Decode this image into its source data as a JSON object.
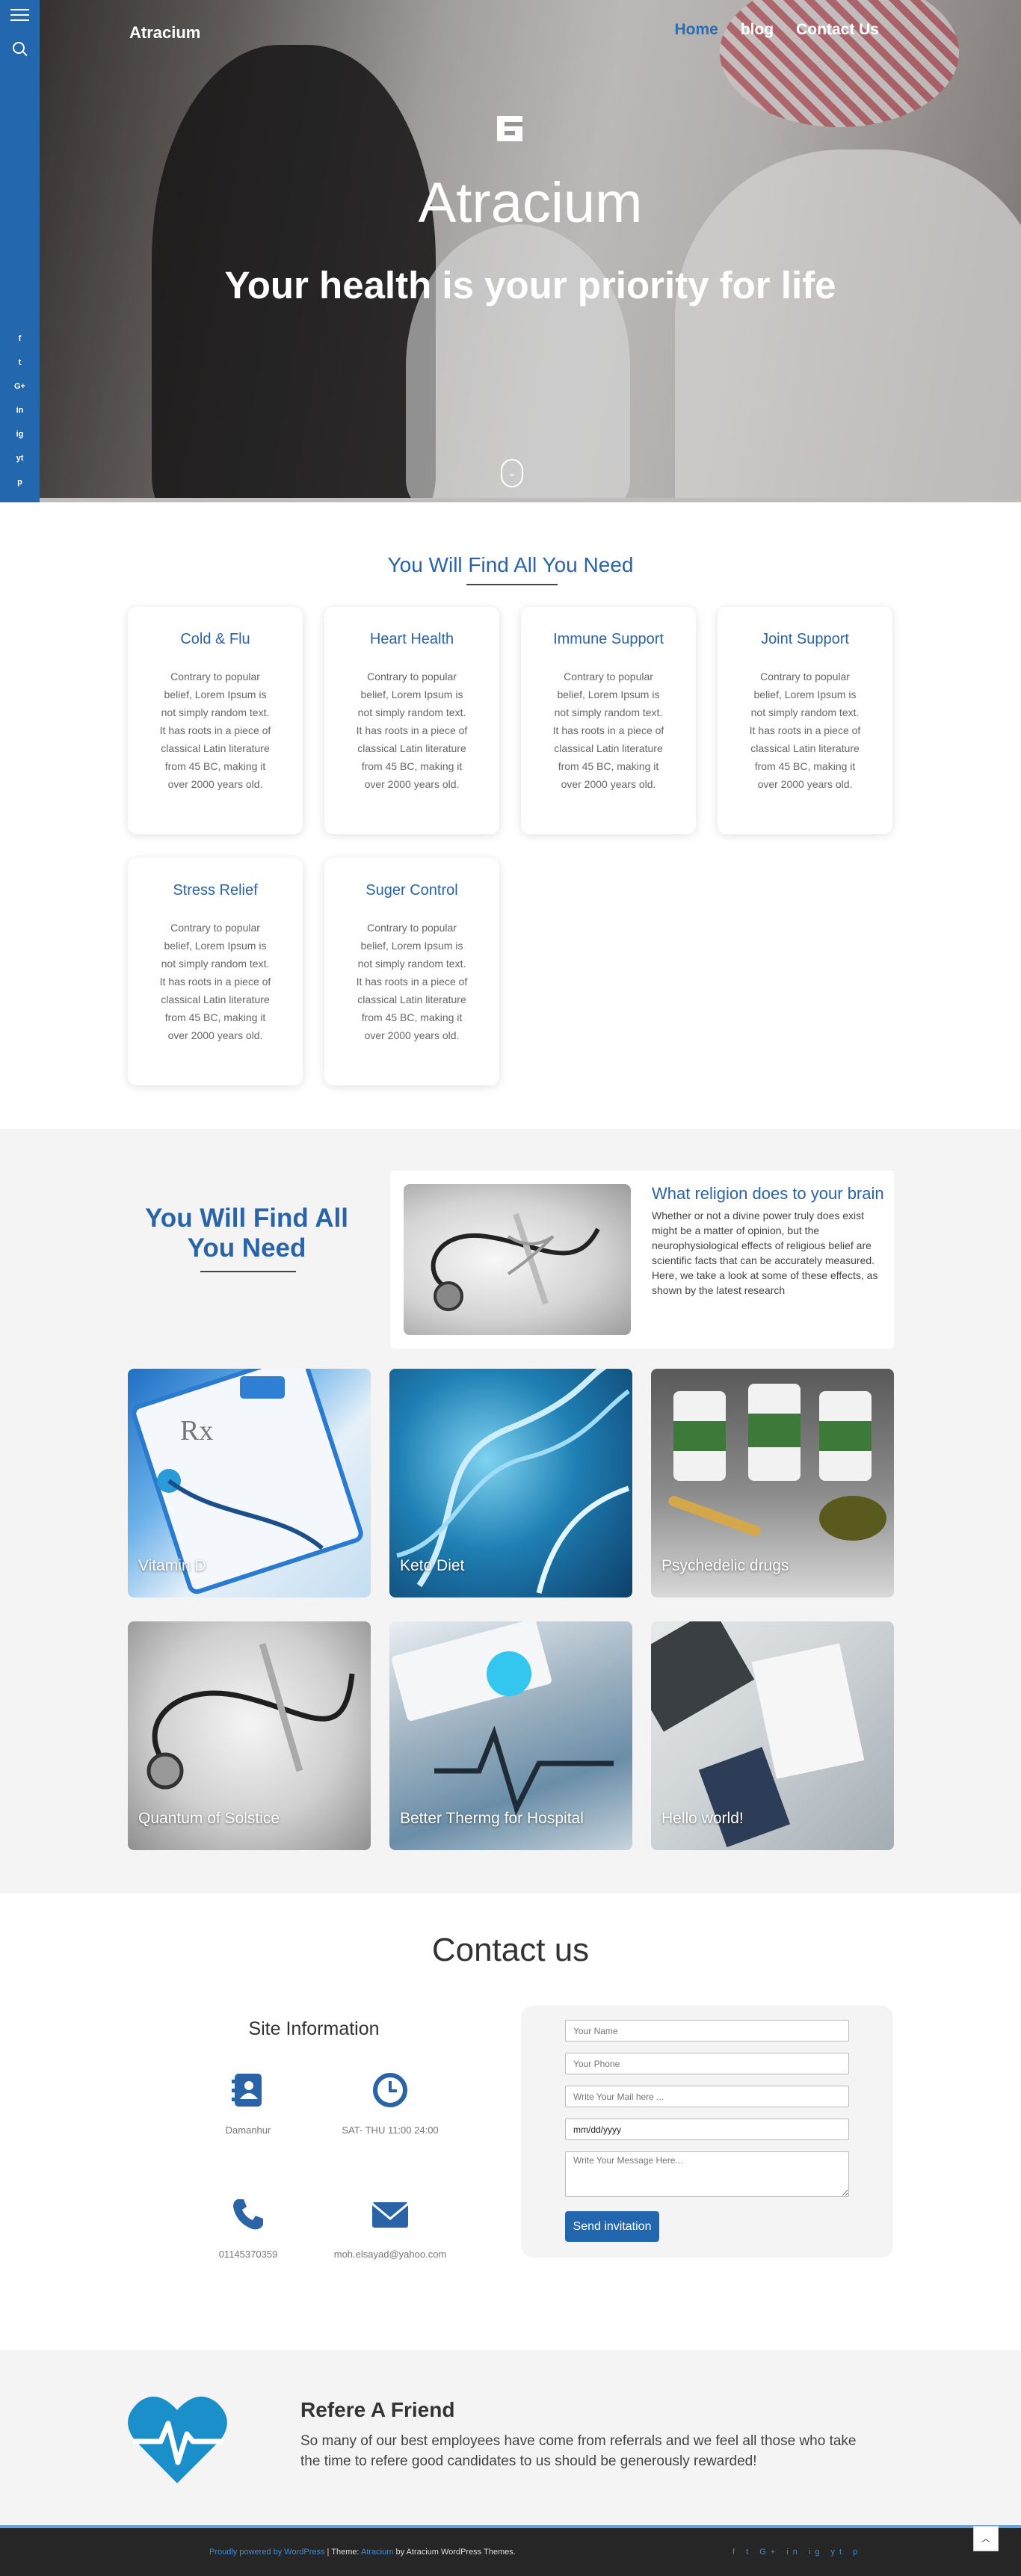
{
  "sidebar": {
    "social": [
      "f",
      "t",
      "G+",
      "in",
      "ig",
      "yt",
      "p"
    ]
  },
  "header": {
    "brand": "Atracium",
    "nav": [
      {
        "label": "Home",
        "active": true
      },
      {
        "label": "blog",
        "active": false
      },
      {
        "label": "Contact Us",
        "active": false
      }
    ]
  },
  "hero": {
    "title": "Atracium",
    "subtitle": "Your health is your priority for life"
  },
  "services": {
    "title": "You Will Find All You Need",
    "cards": [
      {
        "title": "Cold & Flu",
        "text": "Contrary to popular belief, Lorem Ipsum is not simply random text. It has roots in a piece of classical Latin literature from 45 BC, making it over 2000 years old."
      },
      {
        "title": "Heart Health",
        "text": "Contrary to popular belief, Lorem Ipsum is not simply random text. It has roots in a piece of classical Latin literature from 45 BC, making it over 2000 years old."
      },
      {
        "title": "Immune Support",
        "text": "Contrary to popular belief, Lorem Ipsum is not simply random text. It has roots in a piece of classical Latin literature from 45 BC, making it over 2000 years old."
      },
      {
        "title": "Joint Support",
        "text": "Contrary to popular belief, Lorem Ipsum is not simply random text. It has roots in a piece of classical Latin literature from 45 BC, making it over 2000 years old."
      },
      {
        "title": "Stress Relief",
        "text": "Contrary to popular belief, Lorem Ipsum is not simply random text. It has roots in a piece of classical Latin literature from 45 BC, making it over 2000 years old."
      },
      {
        "title": "Suger Control",
        "text": "Contrary to popular belief, Lorem Ipsum is not simply random text. It has roots in a piece of classical Latin literature from 45 BC, making it over 2000 years old."
      }
    ]
  },
  "featured": {
    "title": "You Will Find All You Need",
    "post_title": "What religion does to your brain",
    "post_text": "Whether or not a divine power truly does exist might be a matter of opinion, but the neurophysiological effects of religious belief are scientific facts that can be accurately measured. Here, we take a look at some of these effects, as shown by the latest research",
    "tiles": [
      {
        "label": "Vitamin D"
      },
      {
        "label": "Keto Diet"
      },
      {
        "label": "Psychedelic drugs"
      },
      {
        "label": "Quantum of Solstice"
      },
      {
        "label": "Better Thermg for Hospital"
      },
      {
        "label": "Hello world!"
      }
    ]
  },
  "contact": {
    "title": "Contact us",
    "info_title": "Site Information",
    "items": [
      {
        "icon": "address-book-icon",
        "text": "Damanhur"
      },
      {
        "icon": "clock-icon",
        "text": "SAT- THU 11:00 24:00"
      },
      {
        "icon": "phone-icon",
        "text": "01145370359"
      },
      {
        "icon": "envelope-icon",
        "text": "moh.elsayad@yahoo.com"
      }
    ],
    "form": {
      "name_placeholder": "Your Name",
      "phone_placeholder": "Your Phone",
      "mail_placeholder": "Write Your Mail here ...",
      "date_value": "mm/dd/yyyy",
      "message_placeholder": "Write Your Message Here...",
      "submit_label": "Send invitation"
    }
  },
  "refer": {
    "title": "Refere A Friend",
    "text": "So many of our best employees have come from referrals and we feel all those who take the time to refere good candidates to us should be generously rewarded!"
  },
  "footer": {
    "powered": "Proudly powered by WordPress",
    "theme_label": " | Theme: ",
    "theme_name": "Atracium",
    "by_text": " by Atracium WordPress Themes.",
    "social": "f t G+ in ig yt p"
  },
  "colors": {
    "primary": "#2367ae",
    "accent_text": "#2a64a6",
    "footer_bg": "#262626",
    "section_gray": "#f4f4f4"
  }
}
